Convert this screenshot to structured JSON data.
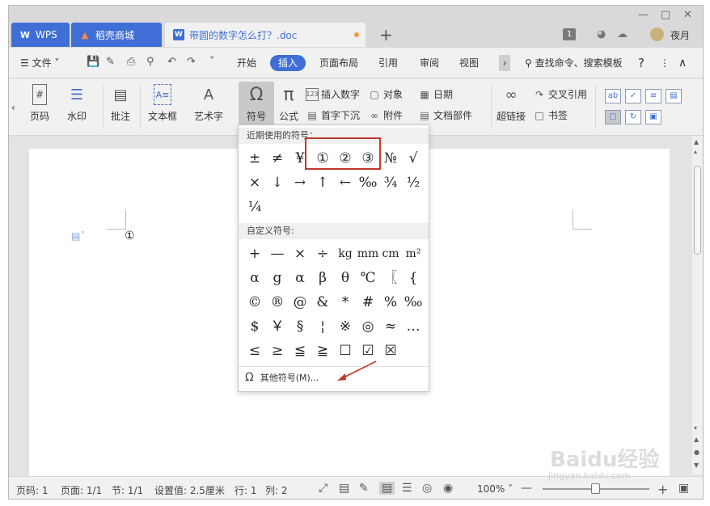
{
  "tabs": {
    "wps": "WPS",
    "daoke": "稻壳商城",
    "document": "带圆的数字怎么打？.doc"
  },
  "user": {
    "name": "夜月",
    "badge": "1"
  },
  "menu": {
    "file": "文件",
    "items": [
      "开始",
      "插入",
      "页面布局",
      "引用",
      "审阅",
      "视图"
    ],
    "search": "查找命令、搜索模板",
    "help": "?"
  },
  "ribbon": {
    "page_number": "页码",
    "watermark": "水印",
    "comment": "批注",
    "textbox": "文本框",
    "wordart": "艺术字",
    "symbol": "符号",
    "formula": "公式",
    "insert_number": "插入数字",
    "object": "对象",
    "date": "日期",
    "drop_cap": "首字下沉",
    "attachment": "附件",
    "doc_parts": "文档部件",
    "hyperlink": "超链接",
    "cross_ref": "交叉引用",
    "bookmark": "书签"
  },
  "symbol_panel": {
    "recent_title": "近期使用的符号：",
    "recent": [
      "±",
      "≠",
      "¥",
      "①",
      "②",
      "③",
      "№",
      "√",
      "×",
      "↓",
      "→",
      "↑",
      "←",
      "‰",
      "¾",
      "½",
      "¼"
    ],
    "custom_title": "自定义符号:",
    "custom": [
      "+",
      "—",
      "×",
      "÷",
      "kg",
      "mm",
      "cm",
      "m²",
      "α",
      "g",
      "α",
      "β",
      "θ",
      "℃",
      "〖",
      "{",
      "©",
      "®",
      "@",
      "&",
      "*",
      "#",
      "%",
      "‰",
      "$",
      "￥",
      "§",
      "¦",
      "※",
      "◎",
      "≈",
      "…",
      "≤",
      "≥",
      "≦",
      "≧",
      "☐",
      "☑",
      "☒"
    ],
    "more": "其他符号(M)..."
  },
  "document": {
    "content": "①"
  },
  "status": {
    "page_code": "页码: 1",
    "page": "页面: 1/1",
    "section": "节: 1/1",
    "setting": "设置值: 2.5厘米",
    "row": "行: 1",
    "col": "列: 2",
    "zoom": "100%"
  },
  "watermark": {
    "text": "Baidu经验",
    "sub": "jingyan.baidu.com"
  },
  "colors": {
    "accent": "#3f6fd6",
    "highlight_box": "#c0392b"
  }
}
